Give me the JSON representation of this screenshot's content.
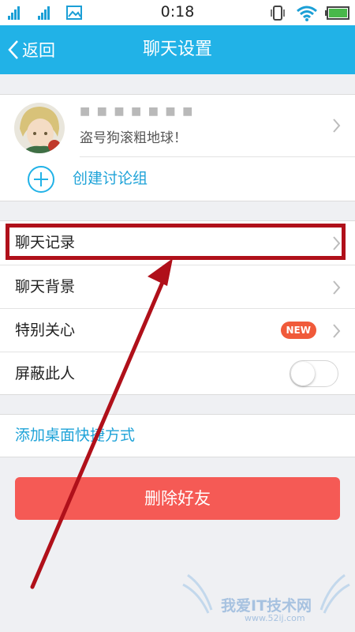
{
  "status_bar": {
    "time": "0:18"
  },
  "nav": {
    "back_label": "返回",
    "title": "聊天设置"
  },
  "profile": {
    "name": "■ ■ ■ ■ ■ ■ ■",
    "signature": "盗号狗滚粗地球！"
  },
  "create_group": {
    "label": "创建讨论组"
  },
  "settings": {
    "chat_history": "聊天记录",
    "chat_background": "聊天背景",
    "special_care": "特别关心",
    "special_care_badge": "NEW",
    "block_user": "屏蔽此人",
    "block_user_enabled": false
  },
  "shortcut": {
    "label": "添加桌面快捷方式"
  },
  "delete_friend": {
    "label": "删除好友"
  },
  "watermark": {
    "text": "我爱IT技术网",
    "url": "www.52ij.com"
  },
  "colors": {
    "accent": "#21b2e7",
    "danger": "#f55a55",
    "badge": "#f05a3a",
    "annotation": "#b0101a"
  }
}
